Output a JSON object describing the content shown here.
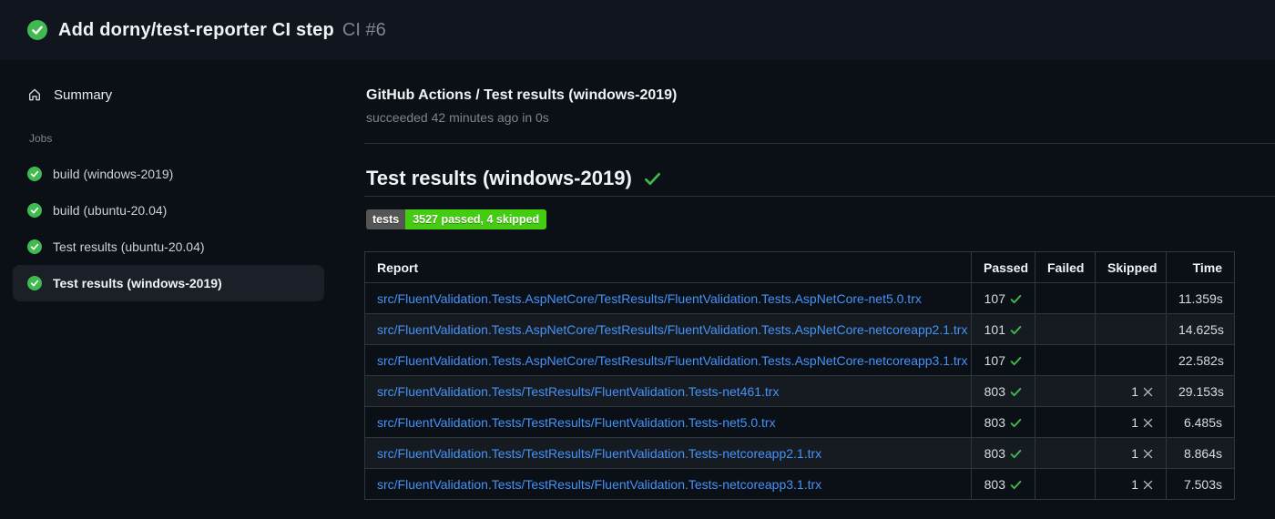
{
  "header": {
    "title": "Add dorny/test-reporter CI step",
    "run_number": "CI #6",
    "status": "success"
  },
  "sidebar": {
    "summary_label": "Summary",
    "jobs_label": "Jobs",
    "jobs": [
      {
        "label": "build (windows-2019)",
        "status": "success",
        "selected": false
      },
      {
        "label": "build (ubuntu-20.04)",
        "status": "success",
        "selected": false
      },
      {
        "label": "Test results (ubuntu-20.04)",
        "status": "success",
        "selected": false
      },
      {
        "label": "Test results (windows-2019)",
        "status": "success",
        "selected": true
      }
    ]
  },
  "main": {
    "check_title": "GitHub Actions / Test results (windows-2019)",
    "check_status": "succeeded 42 minutes ago in 0s",
    "section_title": "Test results (windows-2019)",
    "section_status": "success",
    "badge": {
      "label": "tests",
      "value": "3527 passed, 4 skipped"
    },
    "table": {
      "columns": [
        "Report",
        "Passed",
        "Failed",
        "Skipped",
        "Time"
      ],
      "rows": [
        {
          "report": "src/FluentValidation.Tests.AspNetCore/TestResults/FluentValidation.Tests.AspNetCore-net5.0.trx",
          "passed": "107",
          "failed": "",
          "skipped": "",
          "time": "11.359s"
        },
        {
          "report": "src/FluentValidation.Tests.AspNetCore/TestResults/FluentValidation.Tests.AspNetCore-netcoreapp2.1.trx",
          "passed": "101",
          "failed": "",
          "skipped": "",
          "time": "14.625s"
        },
        {
          "report": "src/FluentValidation.Tests.AspNetCore/TestResults/FluentValidation.Tests.AspNetCore-netcoreapp3.1.trx",
          "passed": "107",
          "failed": "",
          "skipped": "",
          "time": "22.582s"
        },
        {
          "report": "src/FluentValidation.Tests/TestResults/FluentValidation.Tests-net461.trx",
          "passed": "803",
          "failed": "",
          "skipped": "1",
          "time": "29.153s"
        },
        {
          "report": "src/FluentValidation.Tests/TestResults/FluentValidation.Tests-net5.0.trx",
          "passed": "803",
          "failed": "",
          "skipped": "1",
          "time": "6.485s"
        },
        {
          "report": "src/FluentValidation.Tests/TestResults/FluentValidation.Tests-netcoreapp2.1.trx",
          "passed": "803",
          "failed": "",
          "skipped": "1",
          "time": "8.864s"
        },
        {
          "report": "src/FluentValidation.Tests/TestResults/FluentValidation.Tests-netcoreapp3.1.trx",
          "passed": "803",
          "failed": "",
          "skipped": "1",
          "time": "7.503s"
        }
      ]
    }
  },
  "colors": {
    "page_bg": "#0b0f16",
    "header_bg": "#11151d",
    "success_green": "#3fb950",
    "badge_label_bg": "#555555",
    "badge_value_bg": "#44cc11",
    "link_blue": "#4493f8",
    "border": "#30363d",
    "row_alt_bg": "#161b22",
    "muted_text": "#7d8590"
  }
}
